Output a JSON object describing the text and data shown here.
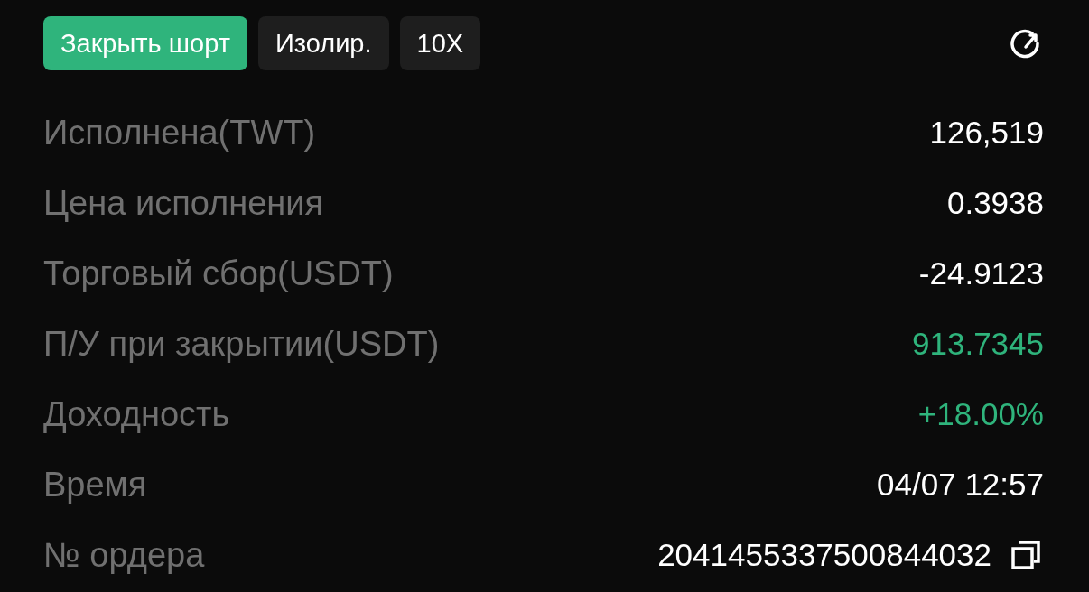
{
  "tags": [
    {
      "label": "Закрыть шорт",
      "kind": "accent"
    },
    {
      "label": "Изолир.",
      "kind": "plain"
    },
    {
      "label": "10X",
      "kind": "plain"
    }
  ],
  "rows": [
    {
      "label": "Исполнена(TWT)",
      "value": "126,519",
      "color": "#ffffff",
      "copyable": false
    },
    {
      "label": "Цена исполнения",
      "value": "0.3938",
      "color": "#ffffff",
      "copyable": false
    },
    {
      "label": "Торговый сбор(USDT)",
      "value": "-24.9123",
      "color": "#ffffff",
      "copyable": false
    },
    {
      "label": "П/У при закрытии(USDT)",
      "value": "913.7345",
      "color": "#2fb47c",
      "copyable": false
    },
    {
      "label": "Доходность",
      "value": "+18.00%",
      "color": "#2fb47c",
      "copyable": false
    },
    {
      "label": "Время",
      "value": "04/07 12:57",
      "color": "#ffffff",
      "copyable": false
    },
    {
      "label": "№ ордера",
      "value": "2041455337500844032",
      "color": "#ffffff",
      "copyable": true
    }
  ]
}
